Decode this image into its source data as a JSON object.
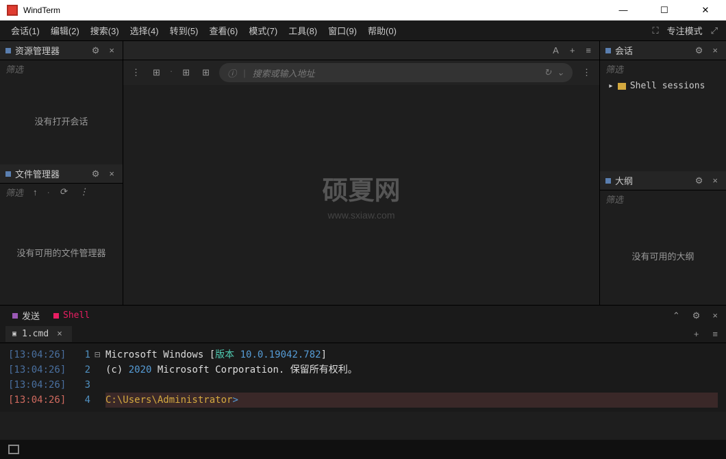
{
  "titlebar": {
    "app_name": "WindTerm"
  },
  "menubar": {
    "items": [
      "会话(1)",
      "编辑(2)",
      "搜索(3)",
      "选择(4)",
      "转到(5)",
      "查看(6)",
      "模式(7)",
      "工具(8)",
      "窗口(9)",
      "帮助(0)"
    ],
    "focus_mode": "专注模式"
  },
  "panels": {
    "explorer": {
      "title": "资源管理器",
      "filter": "筛选",
      "empty": "没有打开会话"
    },
    "file_mgr": {
      "title": "文件管理器",
      "filter": "筛选",
      "empty": "没有可用的文件管理器"
    },
    "session": {
      "title": "会话",
      "filter": "筛选",
      "tree_item": "Shell sessions"
    },
    "outline": {
      "title": "大纲",
      "filter": "筛选",
      "empty": "没有可用的大纲"
    }
  },
  "center": {
    "address_placeholder": "搜索或输入地址",
    "watermark": "硕夏网",
    "watermark_sub": "www.sxiaw.com"
  },
  "bottom": {
    "tabs": {
      "send": "发送",
      "shell": "Shell"
    },
    "filetab": "1.cmd"
  },
  "terminal": {
    "lines": [
      {
        "time": "[13:04:26]",
        "num": "1",
        "fold": "⊟",
        "parts": [
          {
            "t": "Microsoft Windows [",
            "c": ""
          },
          {
            "t": "版本",
            "c": "term-cyan"
          },
          {
            "t": " ",
            "c": ""
          },
          {
            "t": "10.0.19042.782",
            "c": "term-blue"
          },
          {
            "t": "]",
            "c": ""
          }
        ]
      },
      {
        "time": "[13:04:26]",
        "num": "2",
        "fold": "",
        "parts": [
          {
            "t": "(c) ",
            "c": ""
          },
          {
            "t": "2020",
            "c": "term-blue"
          },
          {
            "t": " Microsoft Corporation. 保留所有权利。",
            "c": ""
          }
        ]
      },
      {
        "time": "[13:04:26]",
        "num": "3",
        "fold": "",
        "parts": []
      },
      {
        "time": "[13:04:26]",
        "num": "4",
        "fold": "",
        "active": true,
        "parts": [
          {
            "t": "C:\\Users\\Administrator",
            "c": "term-yellow"
          },
          {
            "t": ">",
            "c": "term-blue"
          }
        ]
      }
    ]
  },
  "icons": {
    "font": "A",
    "plus": "+",
    "menu": "≡",
    "gear": "⚙",
    "close": "×",
    "up": "↑",
    "refresh": "⟳",
    "more": "⋮",
    "info": "ⓘ",
    "reload": "↻",
    "chevron_down": "⌄",
    "chevron_right": "▸",
    "chevron_up": "⌃",
    "minimize": "—",
    "maximize": "☐",
    "win_close": "✕",
    "focus": "⛶",
    "expand": "⤢",
    "new_tab": "⊞"
  }
}
